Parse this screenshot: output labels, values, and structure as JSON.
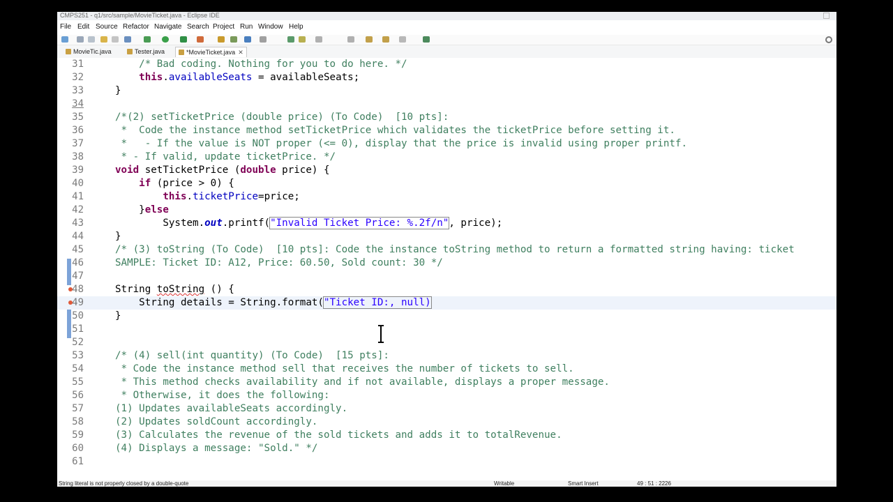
{
  "window": {
    "title": "CMPS251 - q1/src/sample/MovieTicket.java - Eclipse IDE"
  },
  "menu": [
    "File",
    "Edit",
    "Source",
    "Refactor",
    "Navigate",
    "Search",
    "Project",
    "Run",
    "Window",
    "Help"
  ],
  "tabs": [
    {
      "label": "MovieTic.java",
      "active": false
    },
    {
      "label": "Tester.java",
      "active": false
    },
    {
      "label": "*MovieTicket.java",
      "active": true
    }
  ],
  "editor": {
    "lines": [
      {
        "n": "31",
        "text": "    /* Bad coding. Nothing for you to do here. */"
      },
      {
        "n": "32",
        "text": "    this.availableSeats = availableSeats;"
      },
      {
        "n": "33",
        "text": "}"
      },
      {
        "n": "34",
        "text": ""
      },
      {
        "n": "35",
        "text": "/*(2) setTicketPrice (double price) (To Code)  [10 pts]:"
      },
      {
        "n": "36",
        "text": " *  Code the instance method setTicketPrice which validates the ticketPrice before setting it."
      },
      {
        "n": "37",
        "text": " *   - If the value is NOT proper (<= 0), display that the price is invalid using proper printf."
      },
      {
        "n": "38",
        "text": " * - If valid, update ticketPrice. */"
      },
      {
        "n": "39",
        "text": "void setTicketPrice (double price) {"
      },
      {
        "n": "40",
        "text": "    if (price > 0) {"
      },
      {
        "n": "41",
        "text": "        this.ticketPrice=price;"
      },
      {
        "n": "42",
        "text": "    }else"
      },
      {
        "n": "43",
        "text": "        System.out.printf(\"Invalid Ticket Price: %.2f/n\", price);"
      },
      {
        "n": "44",
        "text": "}"
      },
      {
        "n": "45",
        "text": "/* (3) toString (To Code)  [10 pts]: Code the instance toString method to return a formatted string having: ticket"
      },
      {
        "n": "46",
        "text": "SAMPLE: Ticket ID: A12, Price: 60.50, Sold count: 30 */"
      },
      {
        "n": "47",
        "text": ""
      },
      {
        "n": "48",
        "text": "String toString () {"
      },
      {
        "n": "49",
        "text": "    String details = String.format(\"Ticket ID:, null)"
      },
      {
        "n": "50",
        "text": "}"
      },
      {
        "n": "51",
        "text": ""
      },
      {
        "n": "52",
        "text": ""
      },
      {
        "n": "53",
        "text": "/* (4) sell(int quantity) (To Code)  [15 pts]:"
      },
      {
        "n": "54",
        "text": " * Code the instance method sell that receives the number of tickets to sell."
      },
      {
        "n": "55",
        "text": " * This method checks availability and if not available, displays a proper message."
      },
      {
        "n": "56",
        "text": " * Otherwise, it does the following:"
      },
      {
        "n": "57",
        "text": "(1) Updates availableSeats accordingly."
      },
      {
        "n": "58",
        "text": "(2) Updates soldCount accordingly."
      },
      {
        "n": "59",
        "text": "(3) Calculates the revenue of the sold tickets and adds it to totalRevenue."
      },
      {
        "n": "60",
        "text": "(4) Displays a message: \"Sold.\" */"
      },
      {
        "n": "61",
        "text": ""
      }
    ]
  },
  "status": {
    "message": "String literal is not properly closed by a double-quote",
    "mode": "Writable",
    "insert": "Smart Insert",
    "position": "49 : 51 : 2226"
  },
  "colors": {
    "comment": "#3f7f5f",
    "keyword": "#7f0055",
    "field": "#0000c0",
    "string": "#2a00ff",
    "current_line": "#eef3fb"
  },
  "icons": [
    "search-icon",
    "new-file-icon",
    "save-icon",
    "run-icon",
    "debug-icon",
    "close-icon"
  ]
}
